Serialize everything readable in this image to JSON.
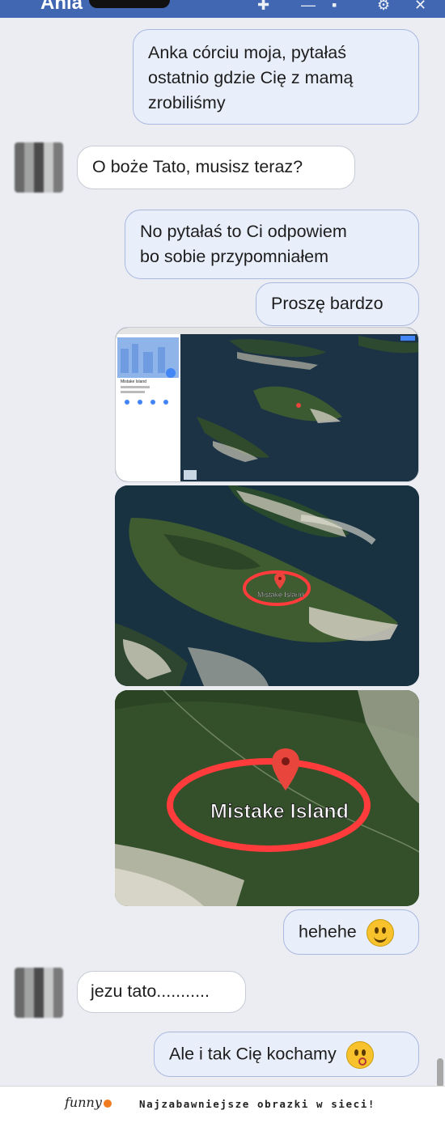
{
  "header": {
    "contact_name": "Ania"
  },
  "messages": {
    "m1": {
      "line1": "Anka córciu moja, pytałaś",
      "line2": "ostatnio gdzie Cię z mamą",
      "line3": "zrobiliśmy"
    },
    "m2": {
      "text": "O boże Tato, musisz teraz?"
    },
    "m3": {
      "line1": "No pytałaś to Ci odpowiem",
      "line2": "bo sobie przypomniałem"
    },
    "m4": {
      "text": "Proszę bardzo"
    },
    "m5": {
      "text": "hehehe"
    },
    "m6": {
      "text": "jezu tato..........."
    },
    "m7": {
      "text": "Ale i tak Cię kochamy"
    }
  },
  "images": {
    "map_screenshot": {
      "place_title": "Mistake Island"
    },
    "map_zoom_1": {
      "label": "Mistake Island"
    },
    "map_zoom_2": {
      "label": "Mistake Island"
    }
  },
  "footer": {
    "logo_text": "funny",
    "tagline": "Najzabawniejsze obrazki w sieci!"
  },
  "colors": {
    "header": "#4267b2",
    "pin": "#e8453c",
    "circle": "#ff3b3b",
    "outgoing_bubble": "#e9eefb"
  }
}
